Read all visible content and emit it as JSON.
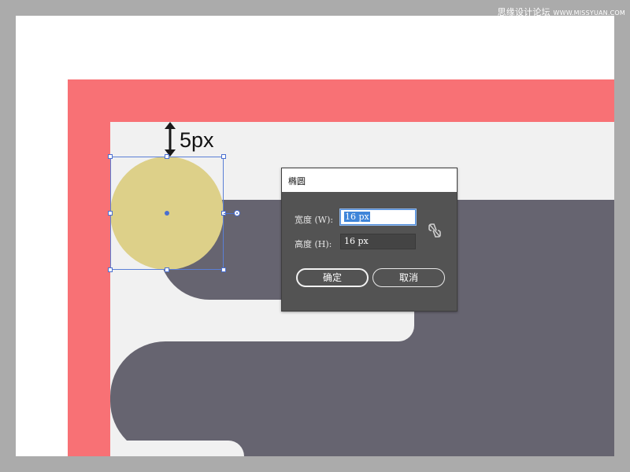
{
  "watermark": {
    "text": "思缘设计论坛",
    "url": "WWW.MISSYUAN.COM"
  },
  "canvas": {
    "dimension_label": "5px",
    "colors": {
      "background": "#ababab",
      "artboard": "#ffffff",
      "frame_red": "#f87175",
      "inner_bg": "#f1f1f1",
      "dark_shape": "#666470",
      "circle_fill": "#ddd089",
      "selection": "#4a6fd0"
    }
  },
  "dialog": {
    "title": "椭圆",
    "width_label": "宽度 (W):",
    "width_value": "16 px",
    "height_label": "高度 (H):",
    "height_value": "16 px",
    "ok_label": "确定",
    "cancel_label": "取消",
    "link_icon": "unlink-chain-icon"
  }
}
